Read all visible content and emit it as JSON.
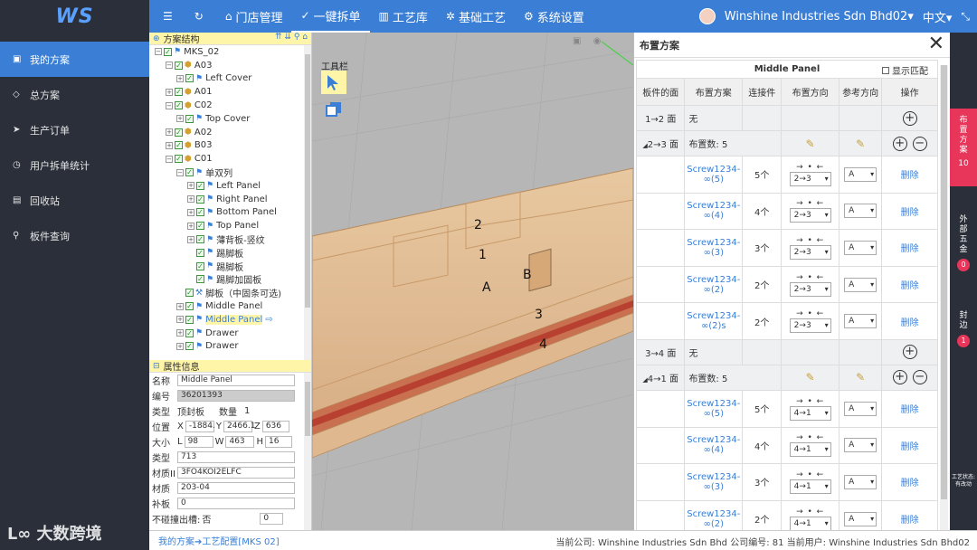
{
  "brand": {
    "logo_text": "WS"
  },
  "topnav": {
    "items": [
      {
        "icon": "menu-icon",
        "label": ""
      },
      {
        "icon": "refresh-icon",
        "label": ""
      },
      {
        "icon": "home-icon",
        "label": "门店管理"
      },
      {
        "icon": "check-circle-icon",
        "label": "一键拆单"
      },
      {
        "icon": "library-icon",
        "label": "工艺库"
      },
      {
        "icon": "gear-icon",
        "label": "基础工艺"
      },
      {
        "icon": "settings-icon",
        "label": "系统设置"
      }
    ],
    "company": "Winshine Industries Sdn Bhd02",
    "language": "中文"
  },
  "sidebar": {
    "items": [
      {
        "label": "我的方案",
        "active": true
      },
      {
        "label": "总方案"
      },
      {
        "label": "生产订单"
      },
      {
        "label": "用户拆单统计"
      },
      {
        "label": "回收站"
      },
      {
        "label": "板件查询"
      }
    ],
    "watermark": "大数跨境"
  },
  "tree": {
    "title": "方案结构",
    "rows": [
      {
        "indent": 0,
        "exp": "-",
        "icon": "flag",
        "label": "MKS_02"
      },
      {
        "indent": 1,
        "exp": "-",
        "icon": "cube",
        "label": "A03"
      },
      {
        "indent": 2,
        "exp": "+",
        "icon": "flag",
        "label": "Left Cover"
      },
      {
        "indent": 1,
        "exp": "+",
        "icon": "cube",
        "label": "A01"
      },
      {
        "indent": 1,
        "exp": "-",
        "icon": "cube",
        "label": "C02"
      },
      {
        "indent": 2,
        "exp": "+",
        "icon": "flag",
        "label": "Top Cover"
      },
      {
        "indent": 1,
        "exp": "+",
        "icon": "cube",
        "label": "A02"
      },
      {
        "indent": 1,
        "exp": "+",
        "icon": "cube",
        "label": "B03"
      },
      {
        "indent": 1,
        "exp": "-",
        "icon": "cube",
        "label": "C01"
      },
      {
        "indent": 2,
        "exp": "-",
        "icon": "flag",
        "label": "单双列"
      },
      {
        "indent": 3,
        "exp": "+",
        "icon": "flag",
        "label": "Left Panel"
      },
      {
        "indent": 3,
        "exp": "+",
        "icon": "flag",
        "label": "Right Panel"
      },
      {
        "indent": 3,
        "exp": "+",
        "icon": "flag",
        "label": "Bottom Panel"
      },
      {
        "indent": 3,
        "exp": "+",
        "icon": "flag",
        "label": "Top Panel"
      },
      {
        "indent": 3,
        "exp": "+",
        "icon": "flag",
        "label": "薄背板-竖纹"
      },
      {
        "indent": 3,
        "exp": "",
        "icon": "flag",
        "label": "踢脚板"
      },
      {
        "indent": 3,
        "exp": "",
        "icon": "flag",
        "label": "踢脚板"
      },
      {
        "indent": 3,
        "exp": "",
        "icon": "flag",
        "label": "踢脚加固板"
      },
      {
        "indent": 2,
        "exp": "",
        "icon": "wrench",
        "label": "脚板（中固条可选)"
      },
      {
        "indent": 2,
        "exp": "+",
        "icon": "flag",
        "label": "Middle Panel"
      },
      {
        "indent": 2,
        "exp": "+",
        "icon": "flag",
        "label": "Middle Panel",
        "selected": true
      },
      {
        "indent": 2,
        "exp": "+",
        "icon": "flag",
        "label": "Drawer"
      },
      {
        "indent": 2,
        "exp": "+",
        "icon": "flag",
        "label": "Drawer"
      }
    ]
  },
  "props": {
    "title": "属性信息",
    "name_label": "名称",
    "name": "Middle Panel",
    "code_label": "编号",
    "code": "36201393",
    "type_label": "类型",
    "type": "顶封板",
    "qty_label": "数量",
    "qty": "1",
    "pos_label": "位置",
    "x_label": "X",
    "x": "-1884.",
    "y_label": "Y",
    "y": "2466.1",
    "z_label": "Z",
    "z": "636",
    "size_label": "大小",
    "l_label": "L",
    "l": "98",
    "w_label": "W",
    "w": "463",
    "h_label": "H",
    "h": "16",
    "type2_label": "类型",
    "type2": "713",
    "matid_label": "材质II",
    "matid": "3FO4KOI2ELFC",
    "mat_label": "材质",
    "mat": "203-04",
    "patch_label": "补板",
    "patch": "0",
    "hole_label": "不碰撞出槽:",
    "hole": "否",
    "hole_val": "0"
  },
  "view": {
    "toolbar_label": "工具栏",
    "annotations": [
      "2",
      "1",
      "A",
      "B",
      "3",
      "4"
    ]
  },
  "layout_panel": {
    "title": "布置方案",
    "subtitle": "Middle Panel",
    "show_match": "显示匹配",
    "headers": [
      "板件的面",
      "布置方案",
      "连接件",
      "布置方向",
      "参考方向",
      "操作"
    ],
    "none": "无",
    "count_prefix": "布置数: 5",
    "delete": "删除",
    "groups": [
      {
        "face": "1→2 面",
        "type": "none"
      },
      {
        "face": "2→3 面",
        "type": "group",
        "rows": [
          {
            "scheme": "Screw1234-∞(5)",
            "conn": "5个",
            "dir": "2→3",
            "ref": "A"
          },
          {
            "scheme": "Screw1234-∞(4)",
            "conn": "4个",
            "dir": "2→3",
            "ref": "A"
          },
          {
            "scheme": "Screw1234-∞(3)",
            "conn": "3个",
            "dir": "2→3",
            "ref": "A"
          },
          {
            "scheme": "Screw1234-∞(2)",
            "conn": "2个",
            "dir": "2→3",
            "ref": "A"
          },
          {
            "scheme": "Screw1234-∞(2)s",
            "conn": "2个",
            "dir": "2→3",
            "ref": "A"
          }
        ]
      },
      {
        "face": "3→4 面",
        "type": "none"
      },
      {
        "face": "4→1 面",
        "type": "group",
        "rows": [
          {
            "scheme": "Screw1234-∞(5)",
            "conn": "5个",
            "dir": "4→1",
            "ref": "A"
          },
          {
            "scheme": "Screw1234-∞(4)",
            "conn": "4个",
            "dir": "4→1",
            "ref": "A"
          },
          {
            "scheme": "Screw1234-∞(3)",
            "conn": "3个",
            "dir": "4→1",
            "ref": "A"
          },
          {
            "scheme": "Screw1234-∞(2)",
            "conn": "2个",
            "dir": "4→1",
            "ref": "A"
          }
        ]
      }
    ]
  },
  "right_tabs": [
    {
      "label": "布置方案",
      "count": "10",
      "active": true
    },
    {
      "label": "外部五金",
      "count": "0"
    },
    {
      "label": "封边",
      "count": "1"
    },
    {
      "label": "工艺状态: 有改动",
      "count": ""
    }
  ],
  "bottom": {
    "breadcrumb": "我的方案➔工艺配置[MKS 02]",
    "info": "当前公司:  Winshine Industries Sdn Bhd    公司编号:  81    当前用户:  Winshine Industries Sdn Bhd02"
  }
}
